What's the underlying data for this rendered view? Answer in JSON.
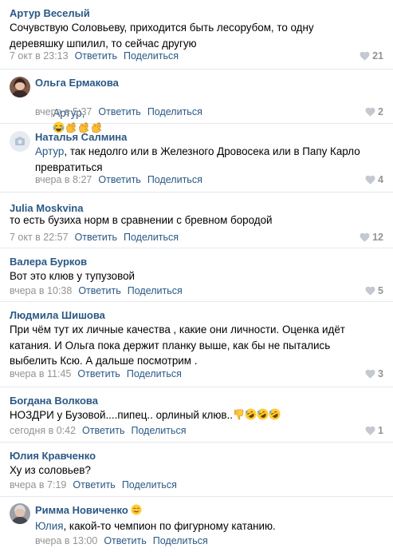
{
  "comments": [
    {
      "author": "Артур Веселый",
      "text": "Сочувствую Соловьеву, приходится быть лесорубом, то одну деревяшку шпилил, то сейчас другую",
      "time": "7 окт в 23:13",
      "reply_label": "Ответить",
      "share_label": "Поделиться",
      "likes": "21"
    },
    {
      "author": "Ольга Ермакова",
      "reply_to": "Артур,",
      "emojis": [
        "tears-of-joy",
        "clapping-hands",
        "clapping-hands",
        "clapping-hands"
      ],
      "time": "вчера в 5:37",
      "reply_label": "Ответить",
      "share_label": "Поделиться",
      "likes": "2"
    },
    {
      "author": "Наталья Салмина",
      "reply_to": "Артур",
      "text": ", так недолго или в Железного Дровосека или в Папу Карло превратиться",
      "time": "вчера в 8:27",
      "reply_label": "Ответить",
      "share_label": "Поделиться",
      "likes": "4"
    },
    {
      "author": "Julia Moskvina",
      "text": "то есть бузиха норм в сравнении с бревном бородой",
      "time": "7 окт в 22:57",
      "reply_label": "Ответить",
      "share_label": "Поделиться",
      "likes": "12"
    },
    {
      "author": "Валера Бурков",
      "text": "Вот это клюв у тупузовой",
      "time": "вчера в 10:38",
      "reply_label": "Ответить",
      "share_label": "Поделиться",
      "likes": "5"
    },
    {
      "author": "Людмила Шишова",
      "text": "При чём тут их личные качества , какие они личности. Оценка идёт катания. И Ольга пока держит планку выше, как бы не пытались выбелить Ксю. А дальше посмотрим .",
      "time": "вчера в 11:45",
      "reply_label": "Ответить",
      "share_label": "Поделиться",
      "likes": "3"
    },
    {
      "author": "Богдана Волкова",
      "text": "НОЗДРИ у Бузовой....пипец.. орлиный клюв..",
      "emojis": [
        "thumbs-down",
        "rolling-on-floor-laughing",
        "rolling-on-floor-laughing",
        "rolling-on-floor-laughing"
      ],
      "time": "сегодня в 0:42",
      "reply_label": "Ответить",
      "share_label": "Поделиться",
      "likes": "1"
    },
    {
      "author": "Юлия Кравченко",
      "text": "Ху из соловьев?",
      "time": "вчера в 7:19",
      "reply_label": "Ответить",
      "share_label": "Поделиться",
      "likes": ""
    },
    {
      "author": "Римма Новиченко",
      "author_emoji": "smiling-face",
      "reply_to": "Юлия",
      "text": ", какой-то чемпион по фигурному катанию.",
      "time": "вчера в 13:00",
      "reply_label": "Ответить",
      "share_label": "Поделиться",
      "likes": ""
    }
  ],
  "colors": {
    "link": "#2a5885",
    "meta": "#939393",
    "divider": "#e7e8ec"
  }
}
